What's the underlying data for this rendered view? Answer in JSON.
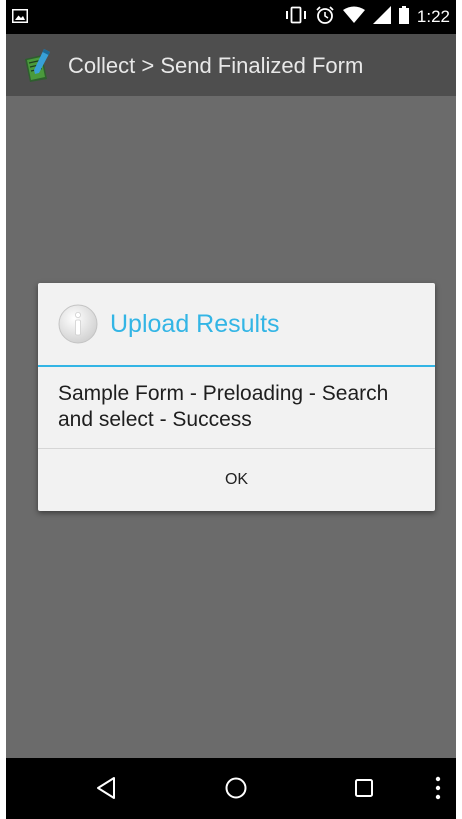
{
  "status_bar": {
    "time": "1:22",
    "icons": [
      "image-notification-icon",
      "vibrate-icon",
      "alarm-icon",
      "wifi-icon",
      "signal-icon",
      "battery-icon"
    ]
  },
  "action_bar": {
    "title": "Collect > Send Finalized Form",
    "icon": "clipboard-pen-icon"
  },
  "dialog": {
    "icon": "info-icon",
    "title": "Upload Results",
    "message": "Sample Form - Preloading - Search and select - Success",
    "ok_label": "OK"
  },
  "nav_bar": {
    "icons": [
      "back-icon",
      "home-icon",
      "recents-icon",
      "overflow-menu-icon"
    ]
  },
  "colors": {
    "accent": "#33b5e5",
    "action_bar": "#4e4e4e",
    "dim_overlay": "#6b6b6b",
    "dialog_bg": "#f2f2f2"
  }
}
